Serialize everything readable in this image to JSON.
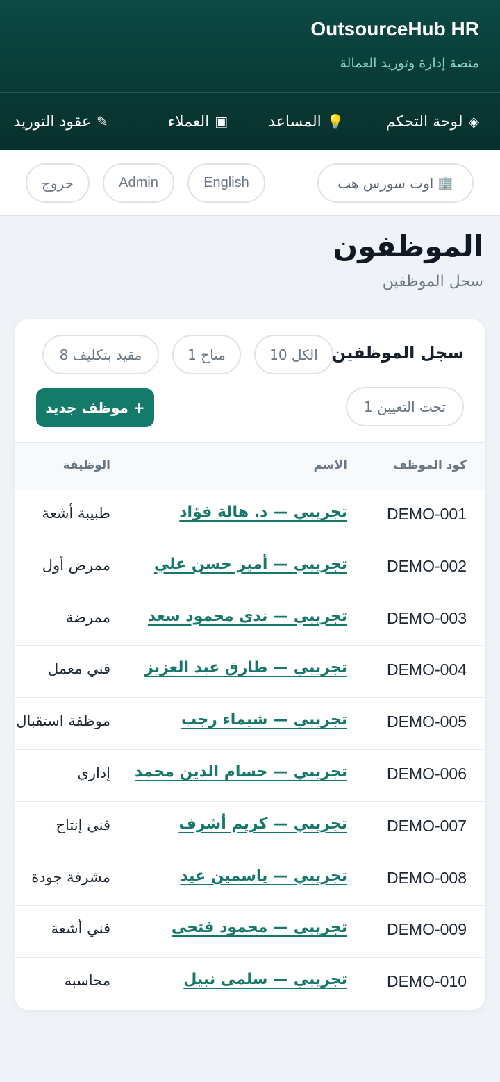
{
  "brand": {
    "title": "OutsourceHub HR",
    "subtitle": "منصة إدارة وتوريد العمالة"
  },
  "nav": {
    "items": [
      {
        "icon": "◈",
        "label": "لوحة التحكم"
      },
      {
        "icon": "💡",
        "label": "المساعد"
      },
      {
        "icon": "▣",
        "label": "العملاء"
      },
      {
        "icon": "✎",
        "label": "عقود التوريد"
      }
    ]
  },
  "topbar": {
    "company_icon": "🏢",
    "company": "اوت سورس هب",
    "language": "English",
    "user": "Admin",
    "logout": "خروج"
  },
  "page": {
    "title": "الموظفون",
    "subtitle": "سجل الموظفين"
  },
  "card": {
    "title": "سجل الموظفين",
    "filters": {
      "all": "الكل 10",
      "available": "متاح 1",
      "assigned": "مقيد بتكليف 8",
      "pending": "تحت التعيين 1"
    },
    "new_button": "+ موظف جديد"
  },
  "table": {
    "headers": {
      "code": "كود الموظف",
      "name": "الاسم",
      "job": "الوظيفة"
    },
    "rows": [
      {
        "code": "DEMO-001",
        "name": "تجريبي — د. هالة فؤاد",
        "job": "طبيبة أشعة"
      },
      {
        "code": "DEMO-002",
        "name": "تجريبي — أمير حسن علي",
        "job": "ممرض أول"
      },
      {
        "code": "DEMO-003",
        "name": "تجريبي — ندى محمود سعد",
        "job": "ممرضة"
      },
      {
        "code": "DEMO-004",
        "name": "تجريبي — طارق عبد العزيز",
        "job": "فني معمل"
      },
      {
        "code": "DEMO-005",
        "name": "تجريبي — شيماء رجب",
        "job": "موظفة استقبال"
      },
      {
        "code": "DEMO-006",
        "name": "تجريبي — حسام الدين محمد",
        "job": "إداري"
      },
      {
        "code": "DEMO-007",
        "name": "تجريبي — كريم أشرف",
        "job": "فني إنتاج"
      },
      {
        "code": "DEMO-008",
        "name": "تجريبي — ياسمين عيد",
        "job": "مشرفة جودة"
      },
      {
        "code": "DEMO-009",
        "name": "تجريبي — محمود فتحي",
        "job": "فني أشعة"
      },
      {
        "code": "DEMO-010",
        "name": "تجريبي — سلمى نبيل",
        "job": "محاسبة"
      }
    ]
  },
  "colors": {
    "header": "#0a3b36",
    "accent": "#147a6a",
    "link": "#16786a",
    "background": "#eff3f7"
  }
}
